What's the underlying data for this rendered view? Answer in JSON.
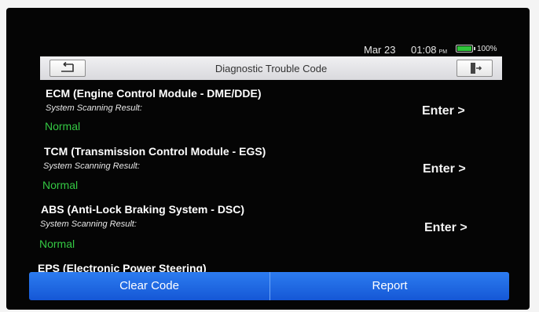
{
  "status": {
    "date": "Mar 23",
    "time": "01:08",
    "ampm": "PM",
    "battery": "100%",
    "battery_level": 1.0,
    "battery_color": "#2fc43a"
  },
  "header": {
    "title": "Diagnostic Trouble Code",
    "back_icon": "back-arrow-icon",
    "exit_icon": "exit-door-icon"
  },
  "modules": [
    {
      "name": "ECM (Engine Control Module - DME/DDE)",
      "result_label": "System Scanning Result:",
      "result": "Normal",
      "enter": "Enter >"
    },
    {
      "name": "TCM (Transmission Control Module - EGS)",
      "result_label": "System Scanning Result:",
      "result": "Normal",
      "enter": "Enter >"
    },
    {
      "name": "ABS (Anti-Lock Braking System - DSC)",
      "result_label": "System Scanning Result:",
      "result": "Normal",
      "enter": "Enter >"
    },
    {
      "name": "EPS (Electronic Power Steering)"
    }
  ],
  "footer": {
    "clear_code": "Clear Code",
    "report": "Report"
  },
  "colors": {
    "normal_status": "#34c843",
    "button_blue": "#1f6be6"
  }
}
